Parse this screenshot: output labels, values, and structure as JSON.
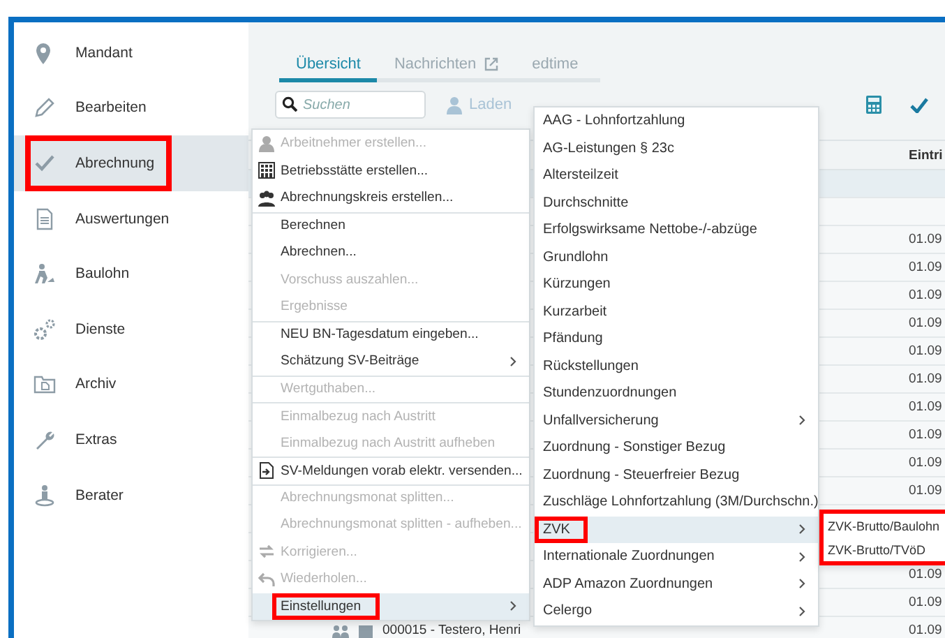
{
  "sidebar": {
    "items": [
      {
        "label": "Mandant",
        "selected": false,
        "highlighted": false
      },
      {
        "label": "Bearbeiten",
        "selected": false,
        "highlighted": false
      },
      {
        "label": "Abrechnung",
        "selected": true,
        "highlighted": true
      },
      {
        "label": "Auswertungen",
        "selected": false,
        "highlighted": false
      },
      {
        "label": "Baulohn",
        "selected": false,
        "highlighted": false
      },
      {
        "label": "Dienste",
        "selected": false,
        "highlighted": false
      },
      {
        "label": "Archiv",
        "selected": false,
        "highlighted": false
      },
      {
        "label": "Extras",
        "selected": false,
        "highlighted": false
      },
      {
        "label": "Berater",
        "selected": false,
        "highlighted": false
      }
    ]
  },
  "tabs": [
    {
      "label": "Übersicht",
      "selected": true
    },
    {
      "label": "Nachrichten",
      "selected": false
    },
    {
      "label": "edtime",
      "selected": false
    }
  ],
  "toolbar": {
    "search": {
      "placeholder": "Suchen"
    },
    "load_button": {
      "label": "Laden",
      "disabled": true
    }
  },
  "table": {
    "columns": [
      "Eintri"
    ],
    "rows": [
      {
        "kind": "group"
      },
      {
        "kind": "row"
      },
      {
        "kind": "row",
        "date": "01.09"
      },
      {
        "kind": "row",
        "date": "01.09"
      },
      {
        "kind": "row",
        "date": "01.09"
      },
      {
        "kind": "row",
        "date": "01.09"
      },
      {
        "kind": "row",
        "date": "01.09"
      },
      {
        "kind": "row",
        "date": "01.09"
      },
      {
        "kind": "row",
        "date": "01.09"
      },
      {
        "kind": "row",
        "date": "01.09"
      },
      {
        "kind": "row",
        "date": "01.09"
      },
      {
        "kind": "row",
        "date": "01.09"
      },
      {
        "kind": "row"
      },
      {
        "kind": "row"
      },
      {
        "kind": "row",
        "date": "01.09"
      },
      {
        "kind": "row",
        "date": "01.09"
      },
      {
        "kind": "row",
        "name": "000015 - Testero, Henri",
        "date": "01.09"
      }
    ]
  },
  "context_menu": {
    "items": [
      {
        "label": "Arbeitnehmer erstellen...",
        "disabled": true,
        "selected": false,
        "submenu": false,
        "separator_before": false,
        "highlighted": false
      },
      {
        "label": "Betriebsstätte erstellen...",
        "disabled": false,
        "selected": false,
        "submenu": false,
        "separator_before": false,
        "highlighted": false
      },
      {
        "label": "Abrechnungskreis erstellen...",
        "disabled": false,
        "selected": false,
        "submenu": false,
        "separator_before": false,
        "highlighted": false
      },
      {
        "label": "Berechnen",
        "disabled": false,
        "selected": false,
        "submenu": false,
        "separator_before": true,
        "highlighted": false
      },
      {
        "label": "Abrechnen...",
        "disabled": false,
        "selected": false,
        "submenu": false,
        "separator_before": false,
        "highlighted": false
      },
      {
        "label": "Vorschuss auszahlen...",
        "disabled": true,
        "selected": false,
        "submenu": false,
        "separator_before": false,
        "highlighted": false
      },
      {
        "label": "Ergebnisse",
        "disabled": true,
        "selected": false,
        "submenu": false,
        "separator_before": false,
        "highlighted": false
      },
      {
        "label": "NEU BN-Tagesdatum eingeben...",
        "disabled": false,
        "selected": false,
        "submenu": false,
        "separator_before": true,
        "highlighted": false
      },
      {
        "label": "Schätzung SV-Beiträge",
        "disabled": false,
        "selected": false,
        "submenu": true,
        "separator_before": false,
        "highlighted": false
      },
      {
        "label": "Wertguthaben...",
        "disabled": true,
        "selected": false,
        "submenu": false,
        "separator_before": true,
        "highlighted": false
      },
      {
        "label": "Einmalbezug nach Austritt",
        "disabled": true,
        "selected": false,
        "submenu": false,
        "separator_before": true,
        "highlighted": false
      },
      {
        "label": "Einmalbezug nach Austritt aufheben",
        "disabled": true,
        "selected": false,
        "submenu": false,
        "separator_before": false,
        "highlighted": false
      },
      {
        "label": "SV-Meldungen vorab elektr. versenden...",
        "disabled": false,
        "selected": false,
        "submenu": false,
        "separator_before": true,
        "highlighted": false
      },
      {
        "label": "Abrechnungsmonat splitten...",
        "disabled": true,
        "selected": false,
        "submenu": false,
        "separator_before": true,
        "highlighted": false
      },
      {
        "label": "Abrechnungsmonat splitten - aufheben...",
        "disabled": true,
        "selected": false,
        "submenu": false,
        "separator_before": false,
        "highlighted": false
      },
      {
        "label": "Korrigieren...",
        "disabled": true,
        "selected": false,
        "submenu": false,
        "separator_before": false,
        "highlighted": false
      },
      {
        "label": "Wiederholen...",
        "disabled": true,
        "selected": false,
        "submenu": false,
        "separator_before": false,
        "highlighted": false
      },
      {
        "label": "Einstellungen",
        "disabled": false,
        "selected": true,
        "submenu": true,
        "separator_before": false,
        "highlighted": true
      }
    ]
  },
  "settings_menu": {
    "items": [
      {
        "label": "AAG - Lohnfortzahlung",
        "selected": false,
        "submenu": false,
        "highlighted": false
      },
      {
        "label": "AG-Leistungen § 23c",
        "selected": false,
        "submenu": false,
        "highlighted": false
      },
      {
        "label": "Altersteilzeit",
        "selected": false,
        "submenu": false,
        "highlighted": false
      },
      {
        "label": "Durchschnitte",
        "selected": false,
        "submenu": false,
        "highlighted": false
      },
      {
        "label": "Erfolgswirksame Nettobe-/-abzüge",
        "selected": false,
        "submenu": false,
        "highlighted": false
      },
      {
        "label": "Grundlohn",
        "selected": false,
        "submenu": false,
        "highlighted": false
      },
      {
        "label": "Kürzungen",
        "selected": false,
        "submenu": false,
        "highlighted": false
      },
      {
        "label": "Kurzarbeit",
        "selected": false,
        "submenu": false,
        "highlighted": false
      },
      {
        "label": "Pfändung",
        "selected": false,
        "submenu": false,
        "highlighted": false
      },
      {
        "label": "Rückstellungen",
        "selected": false,
        "submenu": false,
        "highlighted": false
      },
      {
        "label": "Stundenzuordnungen",
        "selected": false,
        "submenu": false,
        "highlighted": false
      },
      {
        "label": "Unfallversicherung",
        "selected": false,
        "submenu": true,
        "highlighted": false
      },
      {
        "label": "Zuordnung - Sonstiger Bezug",
        "selected": false,
        "submenu": false,
        "highlighted": false
      },
      {
        "label": "Zuordnung - Steuerfreier Bezug",
        "selected": false,
        "submenu": false,
        "highlighted": false
      },
      {
        "label": "Zuschläge Lohnfortzahlung (3M/Durchschn.)",
        "selected": false,
        "submenu": false,
        "highlighted": false
      },
      {
        "label": "ZVK",
        "selected": true,
        "submenu": true,
        "highlighted": true
      },
      {
        "label": "Internationale Zuordnungen",
        "selected": false,
        "submenu": true,
        "highlighted": false
      },
      {
        "label": "ADP Amazon Zuordnungen",
        "selected": false,
        "submenu": true,
        "highlighted": false
      },
      {
        "label": "Celergo",
        "selected": false,
        "submenu": true,
        "highlighted": false
      }
    ]
  },
  "zvk_menu": {
    "highlighted": true,
    "items": [
      {
        "label": "ZVK-Brutto/Baulohn",
        "selected": false
      },
      {
        "label": "ZVK-Brutto/TVöD",
        "selected": false
      }
    ]
  }
}
